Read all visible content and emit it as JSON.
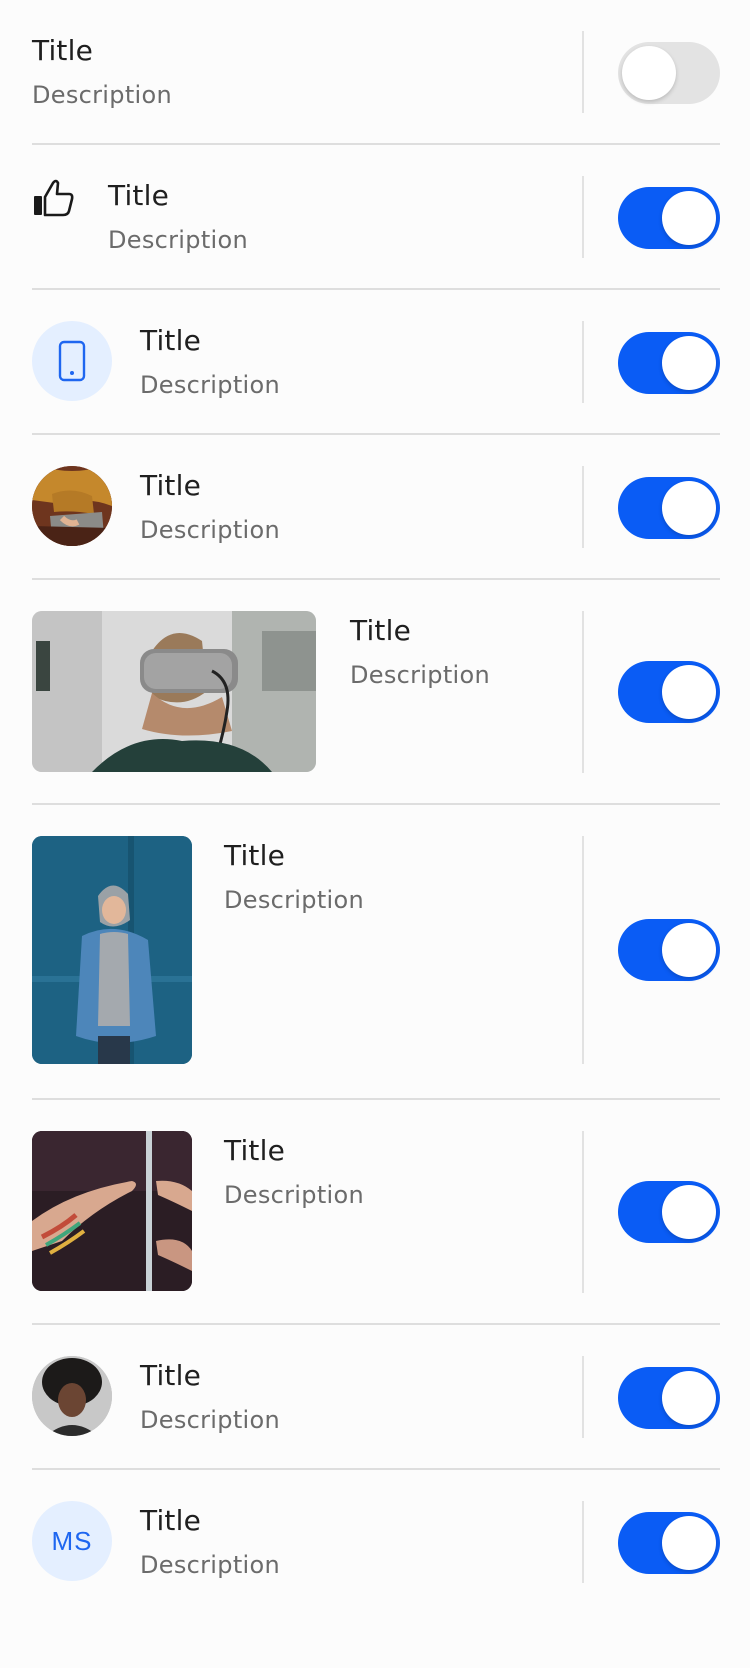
{
  "items": [
    {
      "title": "Title",
      "description": "Description",
      "toggle_on": false,
      "media": "none"
    },
    {
      "title": "Title",
      "description": "Description",
      "toggle_on": true,
      "media": "thumbs-up-icon"
    },
    {
      "title": "Title",
      "description": "Description",
      "toggle_on": true,
      "media": "phone-icon"
    },
    {
      "title": "Title",
      "description": "Description",
      "toggle_on": true,
      "media": "avatar-photo-laptop"
    },
    {
      "title": "Title",
      "description": "Description",
      "toggle_on": true,
      "media": "photo-vr-headset"
    },
    {
      "title": "Title",
      "description": "Description",
      "toggle_on": true,
      "media": "photo-person-denim-jacket"
    },
    {
      "title": "Title",
      "description": "Description",
      "toggle_on": true,
      "media": "photo-hands-mirror"
    },
    {
      "title": "Title",
      "description": "Description",
      "toggle_on": true,
      "media": "avatar-photo-woman"
    },
    {
      "title": "Title",
      "description": "Description",
      "toggle_on": true,
      "media": "initials-avatar",
      "initials": "MS"
    }
  ],
  "colors": {
    "accent": "#0a5cf5",
    "toggle_off": "#e3e3e3",
    "icon_bg": "#e4efff",
    "divider": "#dedede"
  }
}
